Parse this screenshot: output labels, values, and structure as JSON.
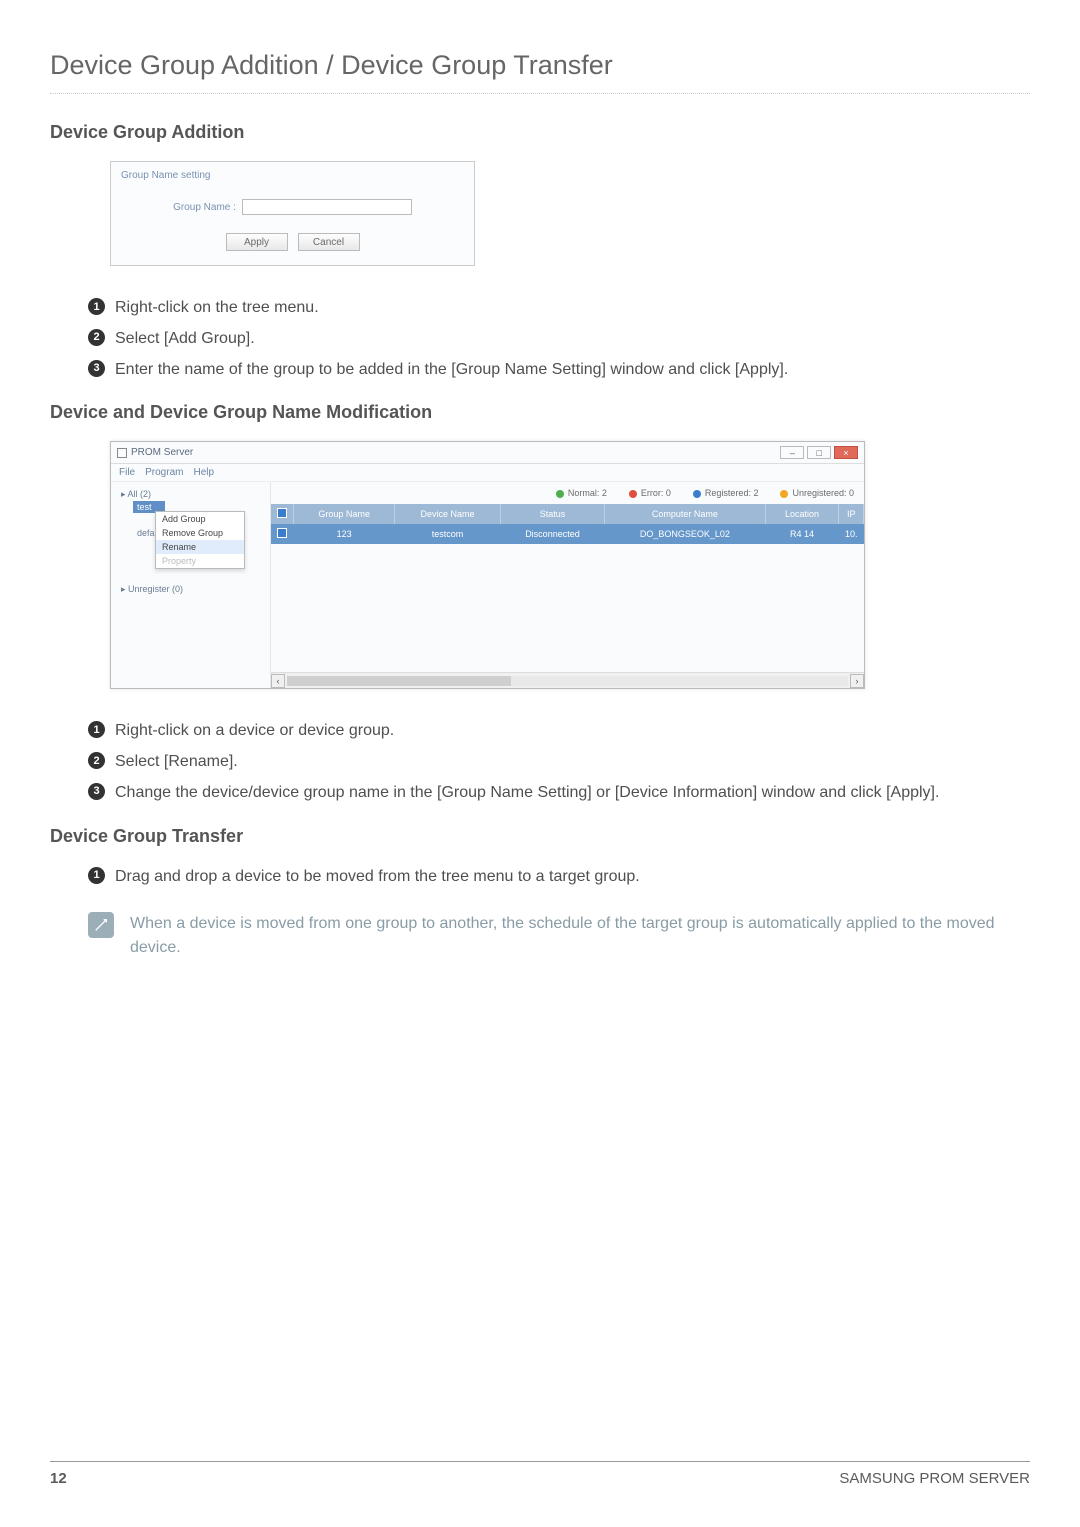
{
  "page": {
    "title": "Device Group Addition / Device Group Transfer"
  },
  "section_addition": {
    "heading": "Device Group Addition",
    "steps": [
      "Right-click on the tree menu.",
      "Select [Add Group].",
      "Enter the name of the group to be added in the [Group Name Setting] window and click [Apply]."
    ]
  },
  "dialog": {
    "title": "Group Name setting",
    "label": "Group Name :",
    "input_value": "",
    "apply": "Apply",
    "cancel": "Cancel"
  },
  "section_modify": {
    "heading": "Device and Device Group Name Modification",
    "steps": [
      "Right-click on a device or device group.",
      "Select [Rename].",
      "Change the device/device group name in the [Group Name Setting] or [Device Information] window and click [Apply]."
    ]
  },
  "app": {
    "window_title": "PROM Server",
    "menu": [
      "File",
      "Program",
      "Help"
    ],
    "tree": {
      "root": "All (2)",
      "items": [
        "test",
        "defa"
      ],
      "unregister": "Unregister (0)"
    },
    "context_menu": {
      "add_group": "Add Group",
      "remove_group": "Remove Group",
      "rename": "Rename",
      "property": "Property"
    },
    "status": {
      "normal": "Normal: 2",
      "error": "Error: 0",
      "registered": "Registered: 2",
      "unregistered": "Unregistered: 0"
    },
    "columns": [
      "",
      "Group Name",
      "Device Name",
      "Status",
      "Computer Name",
      "Location",
      "IP"
    ],
    "rows": [
      {
        "group": "123",
        "device": "testcom",
        "status": "Disconnected",
        "computer": "DO_BONGSEOK_L02",
        "location": "R4 14",
        "ip": "10."
      }
    ]
  },
  "section_transfer": {
    "heading": "Device Group Transfer",
    "steps": [
      "Drag and drop a device to be moved from the tree menu to a target group."
    ],
    "note": "When a device is moved from one group to another, the schedule of the target group is automatically applied to the moved device."
  },
  "footer": {
    "page_number": "12",
    "brand": "SAMSUNG PROM SERVER"
  }
}
